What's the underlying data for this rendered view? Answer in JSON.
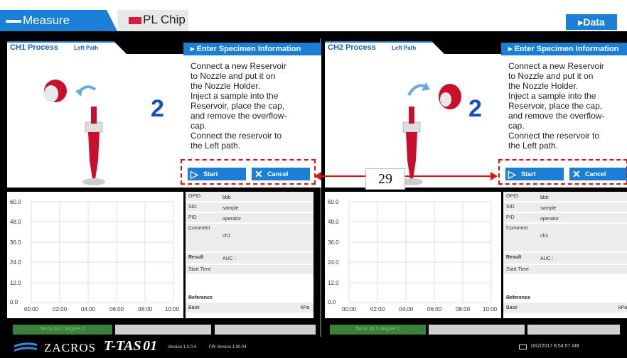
{
  "tabs": {
    "measure": "Measure",
    "plchip": "PL Chip"
  },
  "data_button": "Data",
  "channels": [
    {
      "process_label": "CH1 Process",
      "path_label": "Left Path",
      "step_number": "2",
      "enter_header": "Enter Specimen Information",
      "instructions": "Connect a new Reservoir\nto Nozzle and put it on\nthe Nozzle Holder.\nInject a sample into the\nReservoir, place the cap,\nand remove the overflow-\ncap.\nConnect the reservoir to\nthe Left path.",
      "start_label": "Start",
      "cancel_label": "Cancel",
      "info": {
        "opid_k": "OPID",
        "opid_v": "bbb",
        "sid_k": "SID",
        "sid_v": "sample",
        "pid_k": "PID",
        "pid_v": "operator",
        "comment_k": "Comment",
        "comment_v": "ch1",
        "result_k": "Result",
        "result_v": "AUC  :",
        "start_k": "Start Time",
        "reference": "Reference",
        "base_k": "Base",
        "base_u": "kPa"
      },
      "status": "Temp 36.0 degree C"
    },
    {
      "process_label": "CH2 Process",
      "path_label": "Left Path",
      "step_number": "2",
      "enter_header": "Enter Specimen Information",
      "instructions": "Connect a new Reservoir\nto Nozzle and put it on\nthe Nozzle Holder.\nInject a sample into the\nReservoir, place the cap,\nand remove the overflow-\ncap.\nConnect the reservoir to\nthe Left path.",
      "start_label": "Start",
      "cancel_label": "Cancel",
      "info": {
        "opid_k": "OPID",
        "opid_v": "bbb",
        "sid_k": "SID",
        "sid_v": "sample",
        "pid_k": "PID",
        "pid_v": "operator",
        "comment_k": "Comment",
        "comment_v": "ch2",
        "result_k": "Result",
        "result_v": "AUC  :",
        "start_k": "Start Time",
        "reference": "Reference",
        "base_k": "Base",
        "base_u": "kPa"
      },
      "status": "Temp 36.0 degree C"
    }
  ],
  "chart": {
    "y_ticks": [
      "60.0",
      "48.0",
      "36.0",
      "24.0",
      "12.0",
      "0.0"
    ],
    "x_ticks": [
      "00:00",
      "02:00",
      "04:00",
      "06:00",
      "08:00",
      "10:00"
    ]
  },
  "callout": "29",
  "footer": {
    "company": "ZACROS",
    "product": "T-TAS",
    "product_model": "01",
    "version": "Version 1.0.0.4",
    "fw_version": "FW Version 1.00.04",
    "datetime": "10/2/2017 8:54:57 AM"
  },
  "colors": {
    "accent": "#1b7fd6",
    "brand_red": "#e01a3c",
    "annotation_red": "#e01010"
  }
}
